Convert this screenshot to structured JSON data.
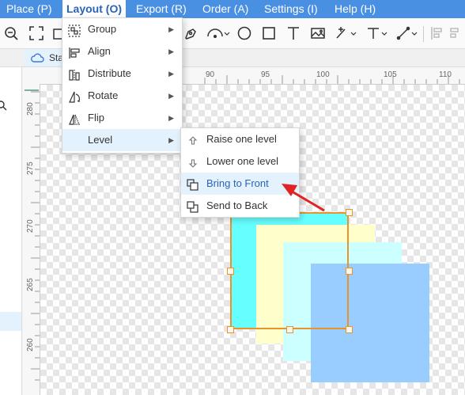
{
  "menubar": {
    "items": [
      "Place (P)",
      "Layout (O)",
      "Export (R)",
      "Order (A)",
      "Settings (I)",
      "Help (H)"
    ],
    "active": "Layout (O)"
  },
  "toolbar": {
    "icons": [
      "zoom-out-icon",
      "fit-screen-icon",
      "select-icon",
      "pen-icon",
      "arc-icon",
      "circle-icon",
      "rectangle-icon",
      "text-icon",
      "image-icon",
      "connector-icon",
      "dimension-icon",
      "measure-icon",
      "align-icon",
      "more-icon"
    ]
  },
  "tab": {
    "label": "Sta"
  },
  "ruler": {
    "top_ticks": [
      "90",
      "95",
      "100",
      "105",
      "110"
    ],
    "left_ticks": [
      "280",
      "275",
      "270",
      "265",
      "260"
    ]
  },
  "layout_menu": {
    "items": [
      {
        "label": "Group",
        "icon": "group-icon"
      },
      {
        "label": "Align",
        "icon": "align-icon"
      },
      {
        "label": "Distribute",
        "icon": "distribute-icon"
      },
      {
        "label": "Rotate",
        "icon": "rotate-icon"
      },
      {
        "label": "Flip",
        "icon": "flip-icon"
      },
      {
        "label": "Level",
        "icon": ""
      }
    ],
    "highlighted": "Level"
  },
  "level_submenu": {
    "items": [
      {
        "label": "Raise one level",
        "icon": "raise-icon"
      },
      {
        "label": "Lower one level",
        "icon": "lower-icon"
      },
      {
        "label": "Bring to Front",
        "icon": "bring-front-icon"
      },
      {
        "label": "Send to Back",
        "icon": "send-back-icon"
      }
    ],
    "highlighted": "Bring to Front"
  },
  "colors": {
    "menubar": "#4a90e2",
    "shape_cyan": "#66ffff",
    "shape_yellow": "#ffffcc",
    "shape_lightcyan": "#ccffff",
    "shape_blue": "#99ccff",
    "selection": "#e8932c",
    "arrow": "#e02424"
  }
}
